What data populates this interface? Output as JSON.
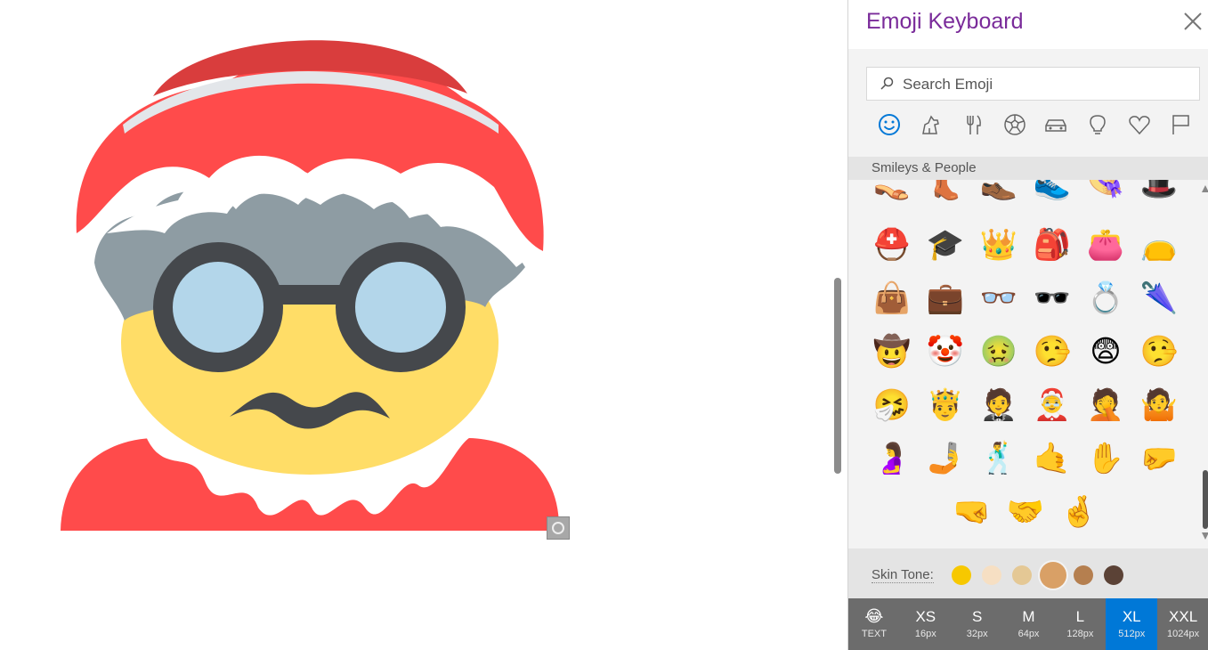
{
  "panel": {
    "title": "Emoji Keyboard",
    "close_label": "close"
  },
  "search": {
    "placeholder": "Search Emoji",
    "value": ""
  },
  "categories": [
    {
      "name": "smileys",
      "icon": "smiley-icon",
      "active": true
    },
    {
      "name": "animals",
      "icon": "dog-icon"
    },
    {
      "name": "food",
      "icon": "fork-knife-icon"
    },
    {
      "name": "activity",
      "icon": "soccer-ball-icon"
    },
    {
      "name": "travel",
      "icon": "car-icon"
    },
    {
      "name": "objects",
      "icon": "lightbulb-icon"
    },
    {
      "name": "symbols",
      "icon": "heart-icon"
    },
    {
      "name": "flags",
      "icon": "flag-icon"
    }
  ],
  "section": {
    "label": "Smileys & People"
  },
  "emoji_rows": [
    [
      "👡",
      "👢",
      "👞",
      "👟",
      "👒",
      "🎩"
    ],
    [
      "⛑️",
      "🎓",
      "👑",
      "🎒",
      "👛",
      "👝"
    ],
    [
      "👜",
      "💼",
      "👓",
      "🕶️",
      "💍",
      "🌂"
    ],
    [
      "🤠",
      "🤡",
      "🤢",
      "🤥",
      "😨",
      "🤥"
    ],
    [
      "🤧",
      "🤴",
      "🤵",
      "🤶",
      "🤦",
      "🤷"
    ],
    [
      "🤰",
      "🤳",
      "🕺",
      "🤙",
      "✋",
      "🤛"
    ],
    [
      "🤜",
      "🤝",
      "🤞"
    ]
  ],
  "skin_tone": {
    "label": "Skin Tone:",
    "swatches": [
      "#f7c800",
      "#f6dfc3",
      "#e4c895",
      "#d9a066",
      "#b57f4f",
      "#5b4236"
    ],
    "selected_index": 3
  },
  "sizes": [
    {
      "emoji": "😂",
      "sub": "TEXT"
    },
    {
      "main": "XS",
      "sub": "16px"
    },
    {
      "main": "S",
      "sub": "32px"
    },
    {
      "main": "M",
      "sub": "64px"
    },
    {
      "main": "L",
      "sub": "128px"
    },
    {
      "main": "XL",
      "sub": "512px",
      "active": true
    },
    {
      "main": "XXL",
      "sub": "1024px"
    }
  ],
  "canvas": {
    "image": "mrs-claus-emoji",
    "colors": {
      "hat": "#ff4b4b",
      "hat_band": "#e3e6ea",
      "hair": "#8e9ca3",
      "face": "#ffdd67",
      "glasses": "#45484c",
      "lens": "#b3d6ea",
      "collar": "#ffffff"
    }
  },
  "accent": "#0078d7",
  "title_color": "#7a2b9a"
}
